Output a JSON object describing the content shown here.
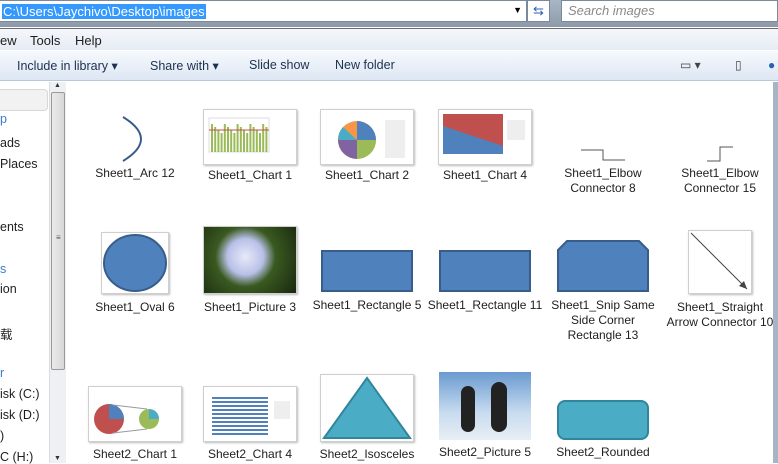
{
  "address": {
    "path": "C:\\Users\\Jaychivo\\Desktop\\images",
    "search_placeholder": "Search images"
  },
  "menu": [
    "ew",
    "Tools",
    "Help"
  ],
  "toolbar": {
    "include": "Include in library",
    "share": "Share with",
    "slideshow": "Slide show",
    "newfolder": "New folder"
  },
  "nav": [
    "p",
    "ads",
    "Places",
    "ents",
    "s",
    "ion",
    "载",
    "r",
    "isk (C:)",
    "isk (D:)",
    ")",
    "C (H:)"
  ],
  "items": [
    {
      "label": "Sheet1_Arc 12",
      "type": "arc"
    },
    {
      "label": "Sheet1_Chart 1",
      "type": "barchart"
    },
    {
      "label": "Sheet1_Chart 2",
      "type": "pie"
    },
    {
      "label": "Sheet1_Chart 4",
      "type": "area"
    },
    {
      "label": "Sheet1_Elbow Connector 8",
      "type": "elbow"
    },
    {
      "label": "Sheet1_Elbow Connector 15",
      "type": "elbow2"
    },
    {
      "label": "Sheet1_Oval 6",
      "type": "oval"
    },
    {
      "label": "Sheet1_Picture 3",
      "type": "flower"
    },
    {
      "label": "Sheet1_Rectangle 5",
      "type": "rect"
    },
    {
      "label": "Sheet1_Rectangle 11",
      "type": "rect"
    },
    {
      "label": "Sheet1_Snip Same Side Corner Rectangle 13",
      "type": "snip"
    },
    {
      "label": "Sheet1_Straight Arrow Connector 10",
      "type": "arrow"
    },
    {
      "label": "Sheet2_Chart 1",
      "type": "pie2"
    },
    {
      "label": "Sheet2_Chart 4",
      "type": "table"
    },
    {
      "label": "Sheet2_Isosceles",
      "type": "tri"
    },
    {
      "label": "Sheet2_Picture 5",
      "type": "penguin"
    },
    {
      "label": "Sheet2_Rounded",
      "type": "round"
    }
  ],
  "colors": {
    "shape": "#4f81bd",
    "shape_border": "#385d8a",
    "select": "#3399ff"
  }
}
